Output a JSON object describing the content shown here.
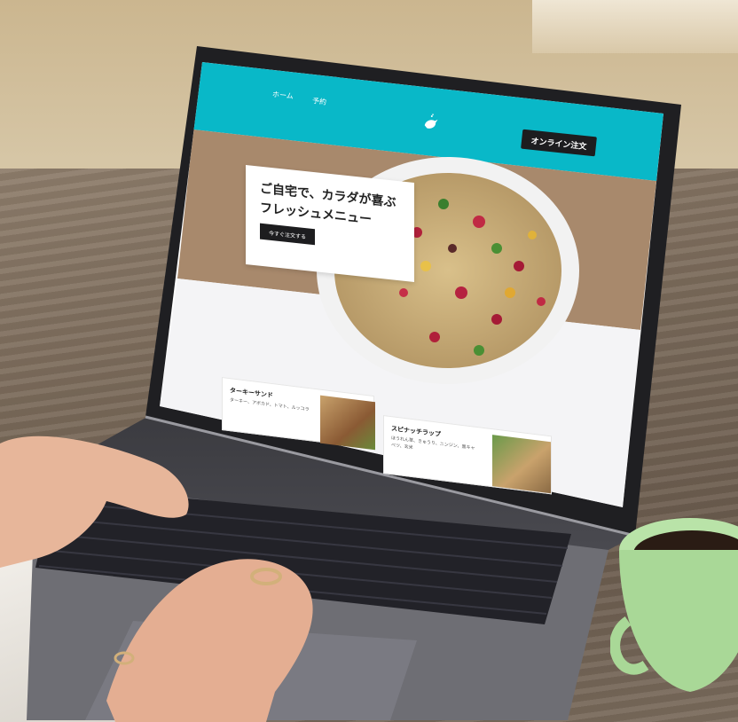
{
  "screen": {
    "nav": {
      "home": "ホーム",
      "reserve": "予約",
      "order_button": "オンライン注文"
    },
    "hero": {
      "title_line1": "ご自宅で、カラダが喜ぶ",
      "title_line2": "フレッシュメニュー",
      "cta": "今すぐ注文する"
    },
    "menu_cards": [
      {
        "name": "ターキーサンド",
        "desc": "ターキー、アボカド、トマト、ルッコラ"
      },
      {
        "name": "スピナッチラップ",
        "desc_line1": "ほうれん草、きゅうり、ニンジン、黒キャ",
        "desc_line2": "ベツ、玄米"
      }
    ]
  },
  "colors": {
    "header": "#09b8c8",
    "hero_bg": "#a8896c",
    "button": "#1d1d1f"
  },
  "icons": [
    "bird-logo-icon"
  ]
}
